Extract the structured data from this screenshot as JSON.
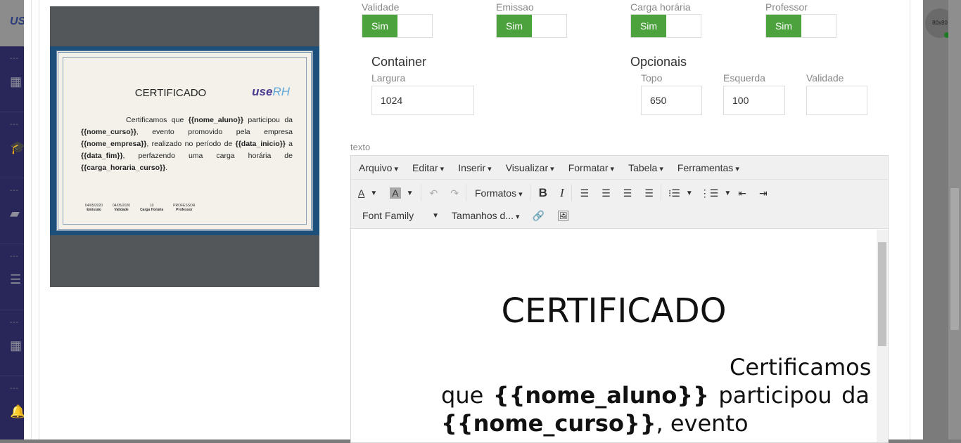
{
  "sidebar": {
    "logo": "USE",
    "items": [
      {
        "dots": "---",
        "icon": "grid-icon",
        "glyph": "▦"
      },
      {
        "dots": "---",
        "icon": "graduation-cap-icon",
        "glyph": "🎓"
      },
      {
        "dots": "---",
        "icon": "book-icon",
        "glyph": "▰"
      },
      {
        "dots": "---",
        "icon": "server-icon",
        "glyph": "☰"
      },
      {
        "dots": "---",
        "icon": "calendar-icon",
        "glyph": "▦"
      },
      {
        "dots": "---",
        "icon": "bell-icon",
        "glyph": "🔔"
      }
    ]
  },
  "avatar": {
    "label": "80x80",
    "status_color": "#1f7a24"
  },
  "preview": {
    "title": "CERTIFICADO",
    "logo_bold": "use",
    "logo_light": "RH",
    "text_parts": [
      "Certificamos que ",
      "{{nome_aluno}}",
      " participou da ",
      "{{nome_curso}}",
      ", evento promovido pela empresa ",
      "{{nome_empresa}}",
      ", realizado no período de ",
      "{{data_inicio}}",
      " a ",
      "{{data_fim}}",
      ", perfazendo uma carga horária de ",
      "{{carga_horaria_curso}}",
      "."
    ],
    "footer": [
      {
        "value": "04/05/2020",
        "label": "Emissão"
      },
      {
        "value": "04/05/2020",
        "label": "Validade"
      },
      {
        "value": "10",
        "label": "Carga Horária"
      },
      {
        "value": "PROFESSOR",
        "label": "Professor"
      }
    ]
  },
  "toggles": [
    {
      "label": "Validade",
      "value": "Sim"
    },
    {
      "label": "Emissao",
      "value": "Sim"
    },
    {
      "label": "Carga horária",
      "value": "Sim"
    },
    {
      "label": "Professor",
      "value": "Sim"
    }
  ],
  "container": {
    "title": "Container",
    "largura_label": "Largura",
    "largura": "1024"
  },
  "opcionais": {
    "title": "Opcionais",
    "topo_label": "Topo",
    "topo": "650",
    "esquerda_label": "Esquerda",
    "esquerda": "100",
    "validade_label": "Validade",
    "validade": ""
  },
  "editor": {
    "label": "texto",
    "menu": [
      "Arquivo",
      "Editar",
      "Inserir",
      "Visualizar",
      "Formatar",
      "Tabela",
      "Ferramentas"
    ],
    "formats": "Formatos",
    "font_family": "Font Family",
    "font_size": "Tamanhos d...",
    "content_title": "CERTIFICADO",
    "content_parts": [
      "Certificamos que ",
      "{{nome_aluno}}",
      " participou da ",
      "{{nome_curso}}",
      ", evento"
    ]
  },
  "colors": {
    "toggle_on": "#4ca23d",
    "sidebar": "#29275a"
  }
}
